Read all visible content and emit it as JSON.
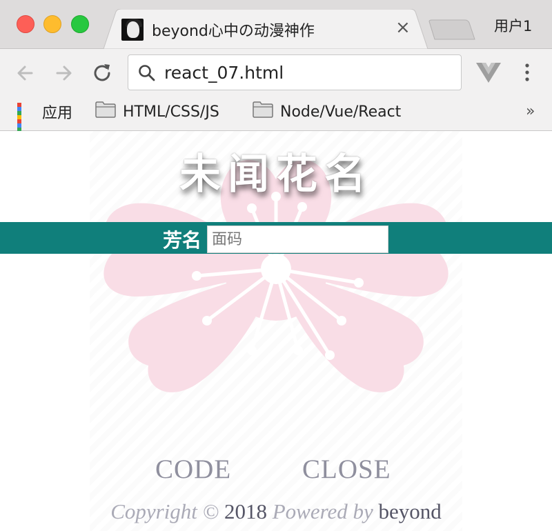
{
  "window": {
    "tab_title": "beyond心中の动漫神作",
    "tab_close": "×",
    "profile": "用户1"
  },
  "toolbar": {
    "url": "react_07.html",
    "icons": [
      "back-arrow-icon",
      "forward-arrow-icon",
      "reload-icon",
      "search-icon",
      "vue-devtools-icon",
      "menu-kebab-icon"
    ]
  },
  "bookmarks": {
    "items": [
      {
        "label": "应用",
        "icon": "apps-grid-icon"
      },
      {
        "label": "HTML/CSS/JS",
        "icon": "folder-icon"
      },
      {
        "label": "Node/Vue/React",
        "icon": "folder-icon"
      }
    ],
    "overflow": "»"
  },
  "page": {
    "heading": "未闻花名",
    "field_label": "芳名",
    "field_placeholder": "面码",
    "field_value": "",
    "buttons": {
      "code": "CODE",
      "close": "CLOSE"
    },
    "copyright": {
      "prefix": "Copyright ©",
      "year": "2018",
      "powered": "Powered by",
      "author": "beyond"
    },
    "colors": {
      "band": "#107f7b",
      "flower": "#f9dde6",
      "button_text": "#8f8f9e"
    }
  }
}
